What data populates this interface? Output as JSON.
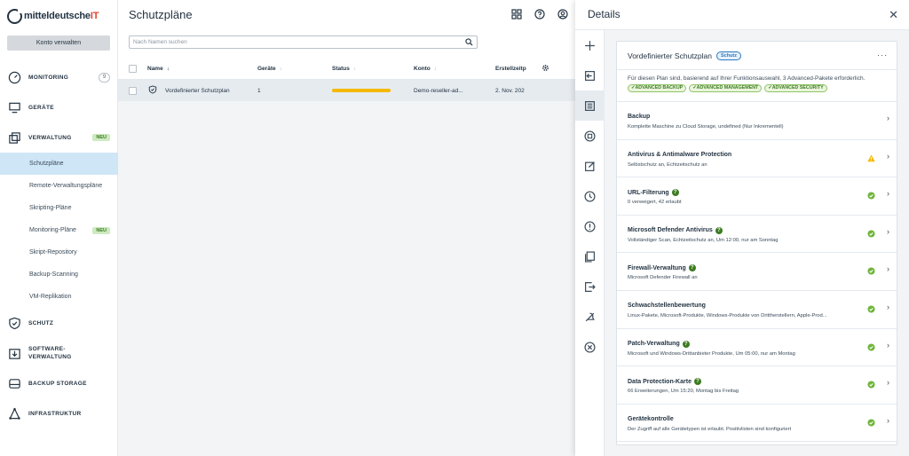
{
  "app": {
    "logo_main": "mitteldeutsche",
    "logo_accent": "IT"
  },
  "sidebar": {
    "account_button": "Konto verwalten",
    "main_items": [
      {
        "label": "MONITORING",
        "count": "9"
      },
      {
        "label": "GERÄTE"
      },
      {
        "label": "VERWALTUNG",
        "badge": "NEU"
      }
    ],
    "sub_items": [
      {
        "label": "Schutzpläne"
      },
      {
        "label": "Remote-Verwaltungspläne"
      },
      {
        "label": "Skripting-Pläne"
      },
      {
        "label": "Monitoring-Pläne",
        "badge": "NEU"
      },
      {
        "label": "Skript-Repository"
      },
      {
        "label": "Backup-Scanning"
      },
      {
        "label": "VM-Replikation"
      }
    ],
    "lower_items": [
      {
        "label": "SCHUTZ"
      },
      {
        "label": "SOFTWARE-\nVERWALTUNG",
        "l1": "SOFTWARE-",
        "l2": "VERWALTUNG"
      },
      {
        "label": "BACKUP STORAGE"
      },
      {
        "label": "INFRASTRUKTUR"
      }
    ]
  },
  "main": {
    "title": "Schutzpläne",
    "search_placeholder": "Nach Namen suchen",
    "columns": {
      "name": "Name",
      "devices": "Geräte",
      "status": "Status",
      "account": "Konto",
      "created": "Erstellzeitp"
    },
    "rows": [
      {
        "name": "Vordefinierter Schutzplan",
        "devices": "1",
        "account": "Demo-reseller-ad...",
        "created": "2. Nov. 202"
      }
    ]
  },
  "details": {
    "title": "Details",
    "plan_title": "Vordefinierter Schutzplan",
    "plan_tag": "Schutz",
    "plan_desc": "Für diesen Plan sind, basierend auf Ihrer Funktionsauswahl, 3 Advanced-Pakete erforderlich.",
    "packages": [
      "✓ADVANCED BACKUP",
      "✓ADVANCED MANAGEMENT",
      "✓ADVANCED SECURITY"
    ],
    "sections": [
      {
        "name": "Backup",
        "sub": "Komplette Maschine zu Cloud Storage, undefined (Nur Inkrementell)",
        "status": "none",
        "help": false
      },
      {
        "name": "Antivirus & Antimalware Protection",
        "sub": "Selbstschutz an, Echtzeitschutz an",
        "status": "warning",
        "help": false
      },
      {
        "name": "URL-Filterung",
        "sub": "0 verweigert, 42 erlaubt",
        "status": "ok",
        "help": true
      },
      {
        "name": "Microsoft Defender Antivirus",
        "sub": "Vollständiger Scan, Echtzeitschutz an, Um 12:00, nur am Sonntag",
        "status": "ok",
        "help": true
      },
      {
        "name": "Firewall-Verwaltung",
        "sub": "Microsoft Defender Firewall an",
        "status": "ok",
        "help": true
      },
      {
        "name": "Schwachstellenbewertung",
        "sub": "Linux-Pakete, Microsoft-Produkte, Windows-Produkte von Drittherstellern, Apple-Prod...",
        "status": "ok",
        "help": false
      },
      {
        "name": "Patch-Verwaltung",
        "sub": "Microsoft und Windows-Drittanbieter Produkte, Um 05:00, nur am Montag",
        "status": "ok",
        "help": true
      },
      {
        "name": "Data Protection-Karte",
        "sub": "66 Erweiterungen, Um 15:20, Montag bis Freitag",
        "status": "ok",
        "help": true
      },
      {
        "name": "Gerätekontrolle",
        "sub": "Der Zugriff auf alle Gerätetypen ist erlaubt. Positivlisten sind konfiguriert",
        "status": "ok",
        "help": false
      }
    ],
    "help_glyph": "?",
    "chevron": "›"
  },
  "colors": {
    "accent": "#2b79c2",
    "ok": "#6fb53a",
    "warning": "#f5b800",
    "brand_red": "#e8412c"
  }
}
